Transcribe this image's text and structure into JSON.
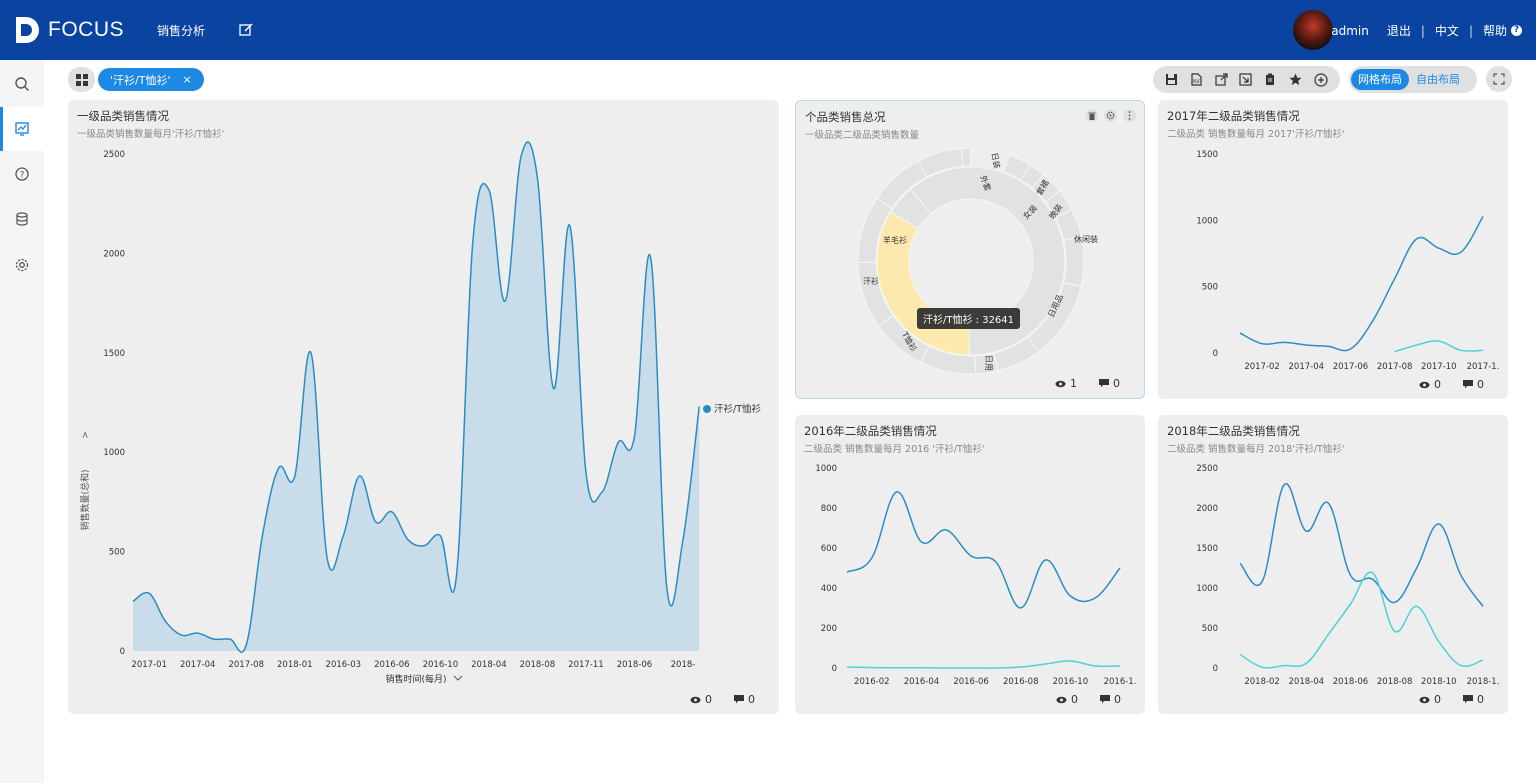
{
  "header": {
    "logo_text": "FOCUS",
    "nav_sales": "销售分析",
    "username": "admin",
    "logout": "退出",
    "language": "中文",
    "help": "帮助",
    "help_icon": "?"
  },
  "sidebar": {
    "items": [
      {
        "icon": "search-icon"
      },
      {
        "icon": "dashboard-icon",
        "active": true
      },
      {
        "icon": "help-icon"
      },
      {
        "icon": "database-icon"
      },
      {
        "icon": "settings-icon"
      }
    ]
  },
  "filter_bar": {
    "chip_label": "'汗衫/T恤衫'",
    "chip_close": "×"
  },
  "toolbar": {
    "icons": [
      "save-icon",
      "export-pdf-icon",
      "share-icon",
      "export-icon",
      "copy-icon",
      "star-icon",
      "add-icon"
    ],
    "grid_layout": "网格布局",
    "free_layout": "自由布局"
  },
  "cards": {
    "main": {
      "title": "一级品类销售情况",
      "subtitle": "一级品类销售数量每月'汗衫/T恤衫'",
      "views": "0",
      "comments": "0",
      "ylabel": "销售数量(总和)",
      "ylabel_arrow": ">",
      "xlabel": "销售时间(每月)",
      "legend": "汗衫/T恤衫"
    },
    "pie": {
      "title": "个品类销售总况",
      "subtitle": "一级品类二级品类销售数量",
      "views": "1",
      "comments": "0",
      "tooltip": "汗衫/T恤衫 : 32641"
    },
    "y2017": {
      "title": "2017年二级品类销售情况",
      "subtitle": "二级品类 销售数量每月 2017'汗衫/T恤衫'",
      "views": "0",
      "comments": "0"
    },
    "y2016": {
      "title": "2016年二级品类销售情况",
      "subtitle": "二级品类 销售数量每月 2016 '汗衫/T恤衫'",
      "views": "0",
      "comments": "0"
    },
    "y2018": {
      "title": "2018年二级品类销售情况",
      "subtitle": "二级品类 销售数量每月 2018'汗衫/T恤衫'",
      "views": "0",
      "comments": "0"
    }
  },
  "colors": {
    "header_bg": "#0b44a0",
    "accent": "#1e88e5",
    "series_main": "#2b8cc4",
    "series_secondary": "#4fd1d9",
    "area_fill": "#c9dcea",
    "pie_highlight": "#fde9ad",
    "pie_base": "#e2e2e2"
  },
  "chart_data": [
    {
      "id": "main",
      "type": "area",
      "x": [
        "",
        "2017-01",
        "",
        "",
        "2017-04",
        "",
        "",
        "2017-08",
        "",
        "",
        "2018-01",
        "",
        "",
        "2016-03",
        "",
        "",
        "2016-06",
        "",
        "",
        "2016-10",
        "",
        "",
        "2018-04",
        "",
        "",
        "2018-08",
        "",
        "",
        "2017-11",
        "",
        "",
        "2018-06",
        "",
        "",
        "2018-"
      ],
      "series": [
        {
          "name": "汗衫/T恤衫",
          "values": [
            250,
            290,
            150,
            80,
            90,
            60,
            60,
            30,
            580,
            920,
            880,
            1500,
            470,
            580,
            880,
            650,
            700,
            560,
            530,
            580,
            380,
            2050,
            2320,
            1760,
            2490,
            2380,
            1320,
            2140,
            900,
            800,
            1050,
            1080,
            1980,
            320,
            560,
            1230
          ]
        }
      ],
      "yticks": [
        0,
        500,
        1000,
        1500,
        2000,
        2500
      ],
      "ylim": [
        0,
        2500
      ],
      "ylabel": "销售数量(总和)",
      "xlabel": "销售时间(每月)",
      "legend": "right"
    },
    {
      "id": "pie",
      "type": "pie",
      "inner_ring": [
        {
          "label": "汗衫/T恤衫",
          "value": 32641,
          "highlight": true
        },
        {
          "label": "",
          "value": 5000
        },
        {
          "label": "",
          "value": 60000
        }
      ],
      "outer_labels": [
        "日装",
        "外套",
        "套裙",
        "女装",
        "晚装",
        "休闲装",
        "日用品",
        "日用",
        "T恤衫",
        "汗衫",
        "羊毛衫"
      ]
    },
    {
      "id": "y2017",
      "type": "line",
      "x": [
        "",
        "2017-02",
        "",
        "2017-04",
        "",
        "2017-06",
        "",
        "2017-08",
        "",
        "2017-10",
        "",
        "2017-1."
      ],
      "yticks": [
        0,
        500,
        1000,
        1500
      ],
      "ylim": [
        0,
        1500
      ],
      "series": [
        {
          "values": [
            150,
            70,
            80,
            60,
            50,
            30,
            240,
            560,
            860,
            790,
            760,
            1030
          ]
        },
        {
          "values": [
            null,
            null,
            null,
            null,
            null,
            null,
            null,
            10,
            60,
            90,
            20,
            20
          ]
        }
      ]
    },
    {
      "id": "y2016",
      "type": "line",
      "x": [
        "",
        "2016-02",
        "",
        "2016-04",
        "",
        "2016-06",
        "",
        "2016-08",
        "",
        "2016-10",
        "",
        "2016-1."
      ],
      "yticks": [
        0,
        200,
        400,
        600,
        800,
        1000
      ],
      "ylim": [
        0,
        1000
      ],
      "series": [
        {
          "values": [
            480,
            550,
            880,
            630,
            690,
            560,
            530,
            300,
            540,
            360,
            350,
            500
          ]
        },
        {
          "values": [
            5,
            2,
            1,
            1,
            0,
            0,
            0,
            5,
            20,
            35,
            10,
            10
          ]
        }
      ]
    },
    {
      "id": "y2018",
      "type": "line",
      "x": [
        "",
        "2018-02",
        "",
        "2018-04",
        "",
        "2018-06",
        "",
        "2018-08",
        "",
        "2018-10",
        "",
        "2018-1."
      ],
      "yticks": [
        0,
        500,
        1000,
        1500,
        2000,
        2500
      ],
      "ylim": [
        0,
        2500
      ],
      "series": [
        {
          "values": [
            1310,
            1080,
            2290,
            1710,
            2060,
            1160,
            1110,
            820,
            1250,
            1800,
            1160,
            770
          ]
        },
        {
          "values": [
            170,
            10,
            30,
            60,
            420,
            800,
            1190,
            460,
            770,
            330,
            30,
            100
          ]
        }
      ]
    }
  ]
}
